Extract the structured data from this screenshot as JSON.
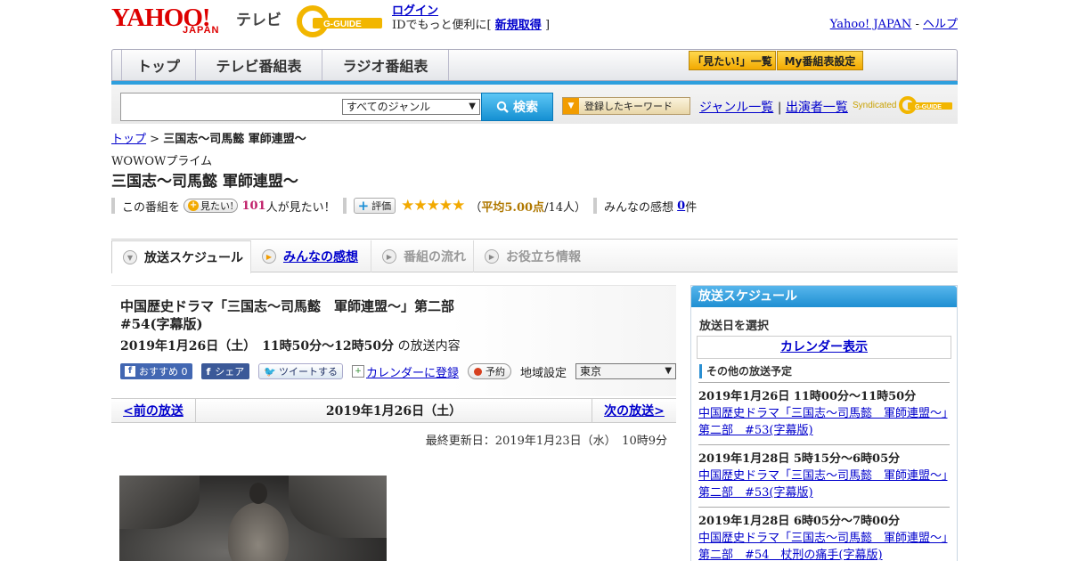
{
  "header": {
    "logo_yahoo": "YAHOO!",
    "logo_japan": "JAPAN",
    "logo_tv": "テレビ",
    "logo_gguide": "G-GUIDE",
    "login": "ログイン",
    "login_prompt_prefix": "IDでもっと便利に[",
    "signup": "新規取得",
    "login_prompt_suffix": "]",
    "yahoo_japan_link": "Yahoo! JAPAN",
    "separator": "-",
    "help_link": "ヘルプ"
  },
  "nav": {
    "tabs": [
      "トップ",
      "テレビ番組表",
      "ラジオ番組表"
    ],
    "mitai_list": "「見たい!」一覧",
    "my_schedule": "My番組表設定"
  },
  "search": {
    "genre_selected": "すべてのジャンル",
    "button": "検索",
    "keyword_button": "登録したキーワード",
    "genre_list": "ジャンル一覧",
    "divider": "|",
    "performer_list": "出演者一覧",
    "syndicated": "Syndicated",
    "syndicated_logo": "G-GUIDE"
  },
  "breadcrumb": {
    "top": "トップ",
    "sep": ">",
    "current": "三国志～司馬懿 軍師連盟～"
  },
  "program": {
    "channel": "WOWOWプライム",
    "title": "三国志～司馬懿 軍師連盟～",
    "prefix": "この番組を",
    "mitai_button": "見たい!",
    "mitai_count": "101",
    "mitai_suffix": "人が見たい！",
    "hyoka_button": "評価",
    "stars": "★★★★★",
    "avg_open": "（",
    "avg_label": "平均5.00点",
    "avg_count": "/14人）",
    "kanso_label": "みんなの感想",
    "kanso_count": "0",
    "kanso_suffix": "件"
  },
  "tabs": [
    {
      "label": "放送スケジュール",
      "active": true
    },
    {
      "label": "みんなの感想",
      "active": false
    },
    {
      "label": "番組の流れ",
      "active": false
    },
    {
      "label": "お役立ち情報",
      "active": false
    }
  ],
  "episode": {
    "title_line1": "中国歴史ドラマ「三国志～司馬懿　軍師連盟～」第二部",
    "title_line2": "#54(字幕版)",
    "datetime": "2019年1月26日（土）　11時50分～12時50分",
    "datetime_suffix": "の放送内容",
    "fb_recommend": "おすすめ 0",
    "fb_share": "シェア",
    "tweet": "ツイートする",
    "calendar": "カレンダーに登録",
    "reserve": "予約",
    "region_label": "地域設定",
    "region_value": "東京"
  },
  "pager": {
    "prev": "<前の放送",
    "current": "2019年1月26日（土）",
    "next": "次の放送>"
  },
  "updated": "最終更新日：2019年1月23日（水）　10時9分",
  "sidebar": {
    "title": "放送スケジュール",
    "select_date": "放送日を選択",
    "calendar_button": "カレンダー表示",
    "other_head": "その他の放送予定",
    "items": [
      {
        "when": "2019年1月26日  11時00分～11時50分",
        "title": "中国歴史ドラマ「三国志～司馬懿　軍師連盟～」第二部　#53(字幕版)"
      },
      {
        "when": "2019年1月28日  5時15分～6時05分",
        "title": "中国歴史ドラマ「三国志～司馬懿　軍師連盟～」第二部　#53(字幕版)"
      },
      {
        "when": "2019年1月28日  6時05分～7時00分",
        "title": "中国歴史ドラマ「三国志～司馬懿　軍師連盟～」第二部　#54　杖刑の痛手(字幕版)"
      }
    ]
  },
  "colors": {
    "accent_blue": "#1f8fd2",
    "nav_gold": "#f2a900",
    "yahoo_red": "#d00",
    "star": "#f2a900"
  }
}
